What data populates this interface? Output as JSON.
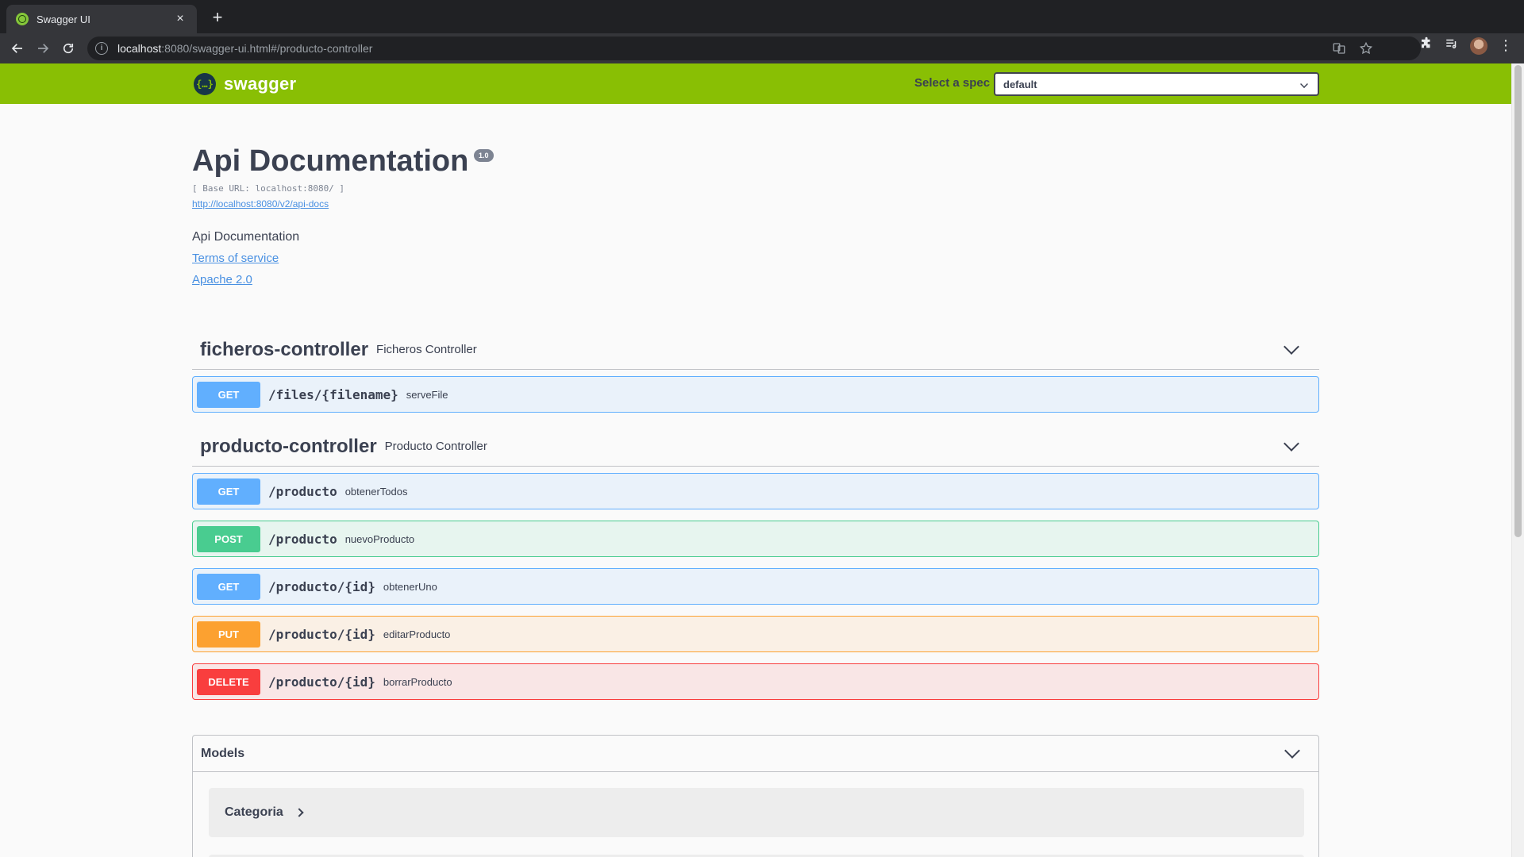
{
  "browser": {
    "tab_title": "Swagger UI",
    "tab_close": "×",
    "new_tab": "+",
    "url_host": "localhost",
    "url_rest": ":8080/swagger-ui.html#/producto-controller",
    "info_glyph": "i",
    "menu": "⋮"
  },
  "header": {
    "logo_symbol": "{…}",
    "logo_text": "swagger",
    "spec_label": "Select a spec",
    "spec_value": "default"
  },
  "info": {
    "title": "Api Documentation",
    "version": "1.0",
    "base_url": "[ Base URL: localhost:8080/ ]",
    "api_docs_link": "http://localhost:8080/v2/api-docs",
    "description": "Api Documentation",
    "terms_link": "Terms of service",
    "license_link": "Apache 2.0"
  },
  "tags": [
    {
      "name": "ficheros-controller",
      "description": "Ficheros Controller",
      "operations": [
        {
          "method": "GET",
          "path": "/files/{filename}",
          "summary": "serveFile"
        }
      ]
    },
    {
      "name": "producto-controller",
      "description": "Producto Controller",
      "operations": [
        {
          "method": "GET",
          "path": "/producto",
          "summary": "obtenerTodos"
        },
        {
          "method": "POST",
          "path": "/producto",
          "summary": "nuevoProducto"
        },
        {
          "method": "GET",
          "path": "/producto/{id}",
          "summary": "obtenerUno"
        },
        {
          "method": "PUT",
          "path": "/producto/{id}",
          "summary": "editarProducto"
        },
        {
          "method": "DELETE",
          "path": "/producto/{id}",
          "summary": "borrarProducto"
        }
      ]
    }
  ],
  "models": {
    "title": "Models",
    "items": [
      "Categoria"
    ]
  },
  "colors": {
    "topbar": "#89bf04",
    "get": "#61affe",
    "post": "#49cc90",
    "put": "#fca130",
    "delete": "#f93e3e"
  }
}
